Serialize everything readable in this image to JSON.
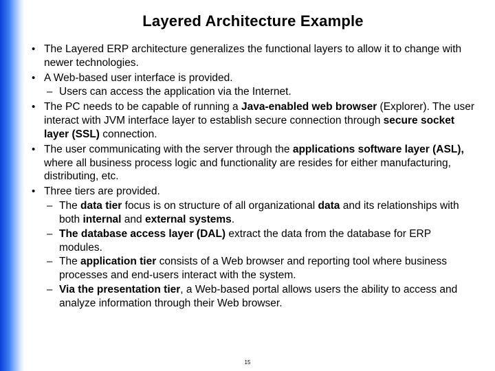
{
  "title": "Layered Architecture Example",
  "page_number": "15",
  "bullets": {
    "b0": "The Layered ERP architecture generalizes the functional layers to allow it to change with newer technologies.",
    "b1": "A Web-based user interface is provided.",
    "b1s0": "Users can access the application via the Internet.",
    "b2a": "The PC needs to be capable of running a ",
    "b2bold1": "Java-enabled web browser",
    "b2b": " (Explorer). The user interact with JVM interface layer to establish secure connection through ",
    "b2bold2": "secure socket layer (SSL)",
    "b2c": " connection.",
    "b3a": "The user communicating with the server through the ",
    "b3bold1": "applications software layer (ASL),",
    "b3b": " where all business process  logic and functionality are resides for either manufacturing, distributing, etc.",
    "b4": "Three tiers are provided.",
    "b4s0a": "The ",
    "b4s0bold1": "data tier",
    "b4s0b": " focus is on structure of all organizational ",
    "b4s0bold2": "data",
    "b4s0c": " and its relationships with both ",
    "b4s0bold3": "internal",
    "b4s0d": " and ",
    "b4s0bold4": "external systems",
    "b4s0e": ".",
    "b4s1bold": "The database access layer (DAL)",
    "b4s1a": " extract the data from the database for ERP modules.",
    "b4s2a": "The ",
    "b4s2bold": "application tier",
    "b4s2b": " consists of a Web browser and reporting tool where business processes and end-users interact with the system.",
    "b4s3bold": "Via the presentation tier",
    "b4s3a": ", a Web-based portal allows users the ability to access and analyze information through their Web browser."
  }
}
